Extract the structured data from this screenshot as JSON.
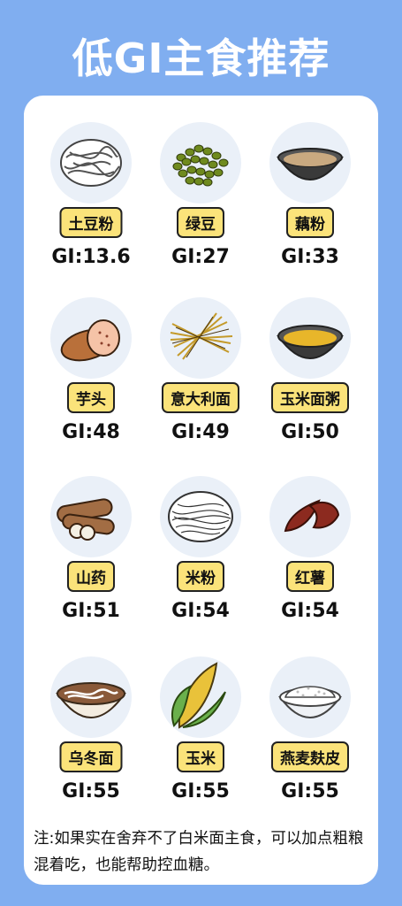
{
  "title": "低GI主食推荐",
  "foods": [
    {
      "name": "土豆粉",
      "gi": "GI:13.6",
      "icon": "potato-noodles-icon"
    },
    {
      "name": "绿豆",
      "gi": "GI:27",
      "icon": "mung-bean-icon"
    },
    {
      "name": "藕粉",
      "gi": "GI:33",
      "icon": "lotus-root-starch-icon"
    },
    {
      "name": "芋头",
      "gi": "GI:48",
      "icon": "taro-icon"
    },
    {
      "name": "意大利面",
      "gi": "GI:49",
      "icon": "spaghetti-icon"
    },
    {
      "name": "玉米面粥",
      "gi": "GI:50",
      "icon": "cornmeal-porridge-icon"
    },
    {
      "name": "山药",
      "gi": "GI:51",
      "icon": "yam-icon"
    },
    {
      "name": "米粉",
      "gi": "GI:54",
      "icon": "rice-noodles-icon"
    },
    {
      "name": "红薯",
      "gi": "GI:54",
      "icon": "sweet-potato-icon"
    },
    {
      "name": "乌冬面",
      "gi": "GI:55",
      "icon": "udon-icon"
    },
    {
      "name": "玉米",
      "gi": "GI:55",
      "icon": "corn-icon"
    },
    {
      "name": "燕麦麸皮",
      "gi": "GI:55",
      "icon": "oat-bran-icon"
    }
  ],
  "note": "注:如果实在舍弃不了白米面主食，可以加点粗粮混着吃，也能帮助控血糖。"
}
